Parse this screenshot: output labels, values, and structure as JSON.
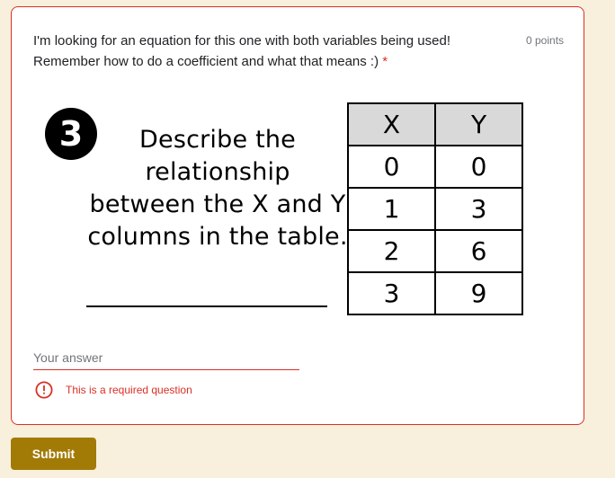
{
  "question": {
    "title": "I'm looking for an equation for this one with both variables being used! Remember how to do a coefficient and what that means :)",
    "required_marker": "*",
    "points": "0 points"
  },
  "figure": {
    "number": "3",
    "prompt_lines": [
      "Describe the",
      "relationship",
      "between the X and Y",
      "columns in the table."
    ],
    "table": {
      "headers": [
        "X",
        "Y"
      ],
      "rows": [
        [
          "0",
          "0"
        ],
        [
          "1",
          "3"
        ],
        [
          "2",
          "6"
        ],
        [
          "3",
          "9"
        ]
      ]
    }
  },
  "answer": {
    "placeholder": "Your answer",
    "value": ""
  },
  "error": {
    "icon": "alert-circle-icon",
    "message": "This is a required question"
  },
  "submit_label": "Submit",
  "colors": {
    "background": "#f8f0dc",
    "error": "#d93025",
    "submit": "#a27a06"
  }
}
